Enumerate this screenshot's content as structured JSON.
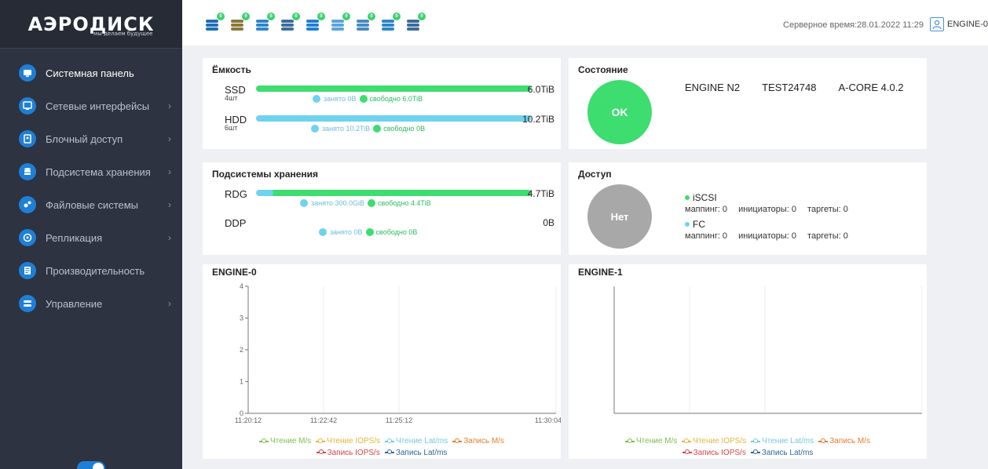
{
  "logo": {
    "text": "АЭРОДИСК",
    "tagline": "мы делаем будущее"
  },
  "menu": [
    {
      "label": "Системная панель",
      "icon": "monitor-icon",
      "arrow": false,
      "active": true
    },
    {
      "label": "Сетевые интерфейсы",
      "icon": "network-icon",
      "arrow": true
    },
    {
      "label": "Блочный доступ",
      "icon": "disk-icon",
      "arrow": true
    },
    {
      "label": "Подсистема хранения",
      "icon": "database-icon",
      "arrow": true
    },
    {
      "label": "Файловые системы",
      "icon": "gears-icon",
      "arrow": true
    },
    {
      "label": "Репликация",
      "icon": "replication-icon",
      "arrow": true
    },
    {
      "label": "Производительность",
      "icon": "performance-icon",
      "arrow": false
    },
    {
      "label": "Управление",
      "icon": "management-icon",
      "arrow": true
    }
  ],
  "topbar": {
    "status_icons": [
      {
        "name": "storage-status-icon",
        "badge": "0"
      },
      {
        "name": "disk-status-icon",
        "badge": "0"
      },
      {
        "name": "network-status-icon",
        "badge": "0"
      },
      {
        "name": "server-status-icon",
        "badge": "0"
      },
      {
        "name": "volume-status-icon",
        "badge": "0"
      },
      {
        "name": "signal-status-icon",
        "badge": "0"
      },
      {
        "name": "settings-status-icon",
        "badge": "0"
      },
      {
        "name": "memory-status-icon",
        "badge": "0"
      },
      {
        "name": "cluster-status-icon",
        "badge": "0"
      }
    ],
    "server_time": "Серверное время:28.01.2022 11:29",
    "user": "ENGINE-0"
  },
  "capacity": {
    "title": "Ёмкость",
    "rows": [
      {
        "label": "SSD",
        "sub": "4шт",
        "total": "6.0TiB",
        "used_text": "занято 0B",
        "free_text": "свободно 6.0TiB",
        "used_fraction": 0.0
      },
      {
        "label": "HDD",
        "sub": "6шт",
        "total": "10.2TiB",
        "used_text": "занято 10.2TiB",
        "free_text": "свободно 0B",
        "used_fraction": 1.0
      }
    ]
  },
  "storage": {
    "title": "Подсистемы хранения",
    "rows": [
      {
        "label": "RDG",
        "total": "4.7TiB",
        "used_text": "занято 300.0GiB",
        "free_text": "свободно 4.4TiB",
        "used_fraction": 0.062,
        "show_bar": true
      },
      {
        "label": "DDP",
        "total": "0B",
        "used_text": "занято 0B",
        "free_text": "свободно 0B",
        "used_fraction": 0,
        "show_bar": false
      }
    ]
  },
  "state": {
    "title": "Состояние",
    "status": "OK",
    "engine": "ENGINE N2",
    "test": "TEST24748",
    "version": "A-CORE 4.0.2"
  },
  "access": {
    "title": "Доступ",
    "status": "Нет",
    "protocols": [
      {
        "name": "iSCSI",
        "color": "#3ddd70",
        "mapping": "маппинг: 0",
        "initiators": "инициаторы: 0",
        "targets": "таргеты: 0"
      },
      {
        "name": "FC",
        "color": "#6ed3ef",
        "mapping": "маппинг: 0",
        "initiators": "инициаторы: 0",
        "targets": "таргеты: 0"
      }
    ]
  },
  "engine0": {
    "title": "ENGINE-0",
    "y_ticks": [
      "0",
      "1",
      "2",
      "3",
      "4"
    ],
    "x_ticks": [
      "11:20:12",
      "11:22:42",
      "11:25:12",
      "11:30:04"
    ]
  },
  "engine1": {
    "title": "ENGINE-1"
  },
  "chart_legend": {
    "row1": [
      {
        "label": "Чтение M/s",
        "color": "#7bbf4a"
      },
      {
        "label": "Чтение IOPS/s",
        "color": "#e8b23a"
      },
      {
        "label": "Чтение Lat/ms",
        "color": "#74c8e0"
      },
      {
        "label": "Запись M/s",
        "color": "#e87a2e"
      }
    ],
    "row2": [
      {
        "label": "Запись IOPS/s",
        "color": "#d64545"
      },
      {
        "label": "Запись Lat/ms",
        "color": "#2c6a9a"
      }
    ]
  },
  "colors": {
    "used": "#6ed3ef",
    "free": "#3ddd70",
    "accent": "#1f7fd6",
    "sidebar": "#2d3340"
  }
}
